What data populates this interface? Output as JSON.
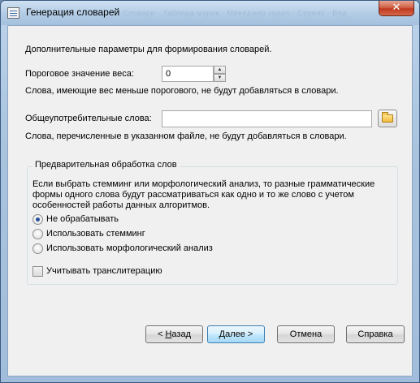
{
  "window": {
    "title": "Генерация словарей",
    "close_glyph": "✕",
    "background_title_ghost": "Словари  ·  Таблица марок  ·  Менеджер задач  ·  Сервис  ·  Вид"
  },
  "intro": {
    "text": "Дополнительные параметры для формирования словарей."
  },
  "threshold": {
    "label": "Пороговое значение веса:",
    "value": "0",
    "up_glyph": "▲",
    "down_glyph": "▼",
    "hint": "Слова, имеющие вес меньше порогового, не будут добавляться в словари."
  },
  "common_words": {
    "label": "Общеупотребительные слова:",
    "value": "",
    "browse_icon": "open-folder-icon",
    "hint": "Слова, перечисленные в указанном файле, не будут добавляться в словари."
  },
  "preprocessing": {
    "title": "Предварительная обработка слов",
    "description_lines": [
      "Если выбрать стемминг или морфологический анализ, то разные грамматические",
      "формы одного слова будут рассматриваться как одно и то же слово с учетом",
      "особенностей работы данных алгоритмов."
    ],
    "options": [
      {
        "label": "Не обрабатывать",
        "checked": true
      },
      {
        "label": "Использовать стемминг",
        "checked": false
      },
      {
        "label": "Использовать морфологический анализ",
        "checked": false
      }
    ],
    "transliteration": {
      "label": "Учитывать транслитерацию",
      "checked": false
    }
  },
  "buttons": {
    "back_prefix": "< ",
    "back_mnemonic": "Н",
    "back_rest": "азад",
    "next_mnemonic": "Д",
    "next_rest": "алее >",
    "cancel": "Отмена",
    "help": "Справка"
  }
}
